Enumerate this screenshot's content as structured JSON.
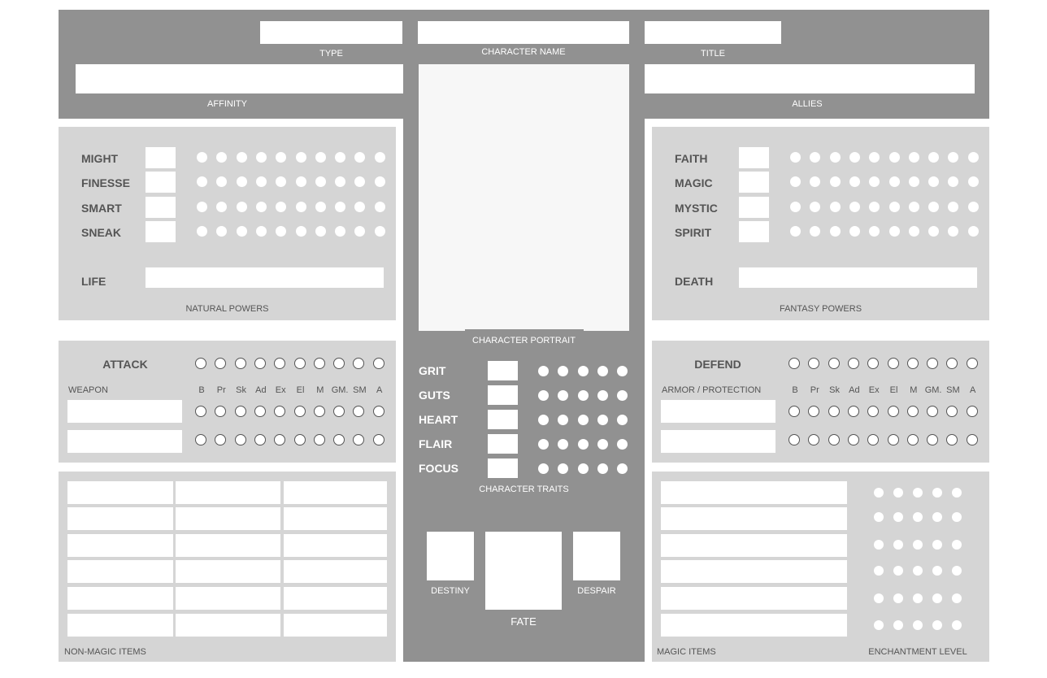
{
  "header": {
    "type_label": "TYPE",
    "name_label": "CHARACTER NAME",
    "title_label": "TITLE",
    "affinity_label": "AFFINITY",
    "allies_label": "ALLIES"
  },
  "portrait_label": "CHARACTER PORTRAIT",
  "natural": {
    "label": "NATURAL POWERS",
    "stats": [
      "MIGHT",
      "FINESSE",
      "SMART",
      "SNEAK"
    ],
    "pool": "LIFE",
    "dots": 10
  },
  "fantasy": {
    "label": "FANTASY POWERS",
    "stats": [
      "FAITH",
      "MAGIC",
      "MYSTIC",
      "SPIRIT"
    ],
    "pool": "DEATH",
    "dots": 10
  },
  "attack": {
    "title": "ATTACK",
    "sub": "WEAPON",
    "columns": [
      "B",
      "Pr",
      "Sk",
      "Ad",
      "Ex",
      "El",
      "M",
      "GM.",
      "SM",
      "A"
    ]
  },
  "defend": {
    "title": "DEFEND",
    "sub": "ARMOR / PROTECTION",
    "columns": [
      "B",
      "Pr",
      "Sk",
      "Ad",
      "Ex",
      "El",
      "M",
      "GM.",
      "SM",
      "A"
    ]
  },
  "traits": {
    "label": "CHARACTER TRAITS",
    "items": [
      "GRIT",
      "GUTS",
      "HEART",
      "FLAIR",
      "FOCUS"
    ],
    "dots": 5
  },
  "fate": {
    "destiny": "DESTINY",
    "fate": "FATE",
    "despair": "DESPAIR"
  },
  "items": {
    "nonmagic": "NON-MAGIC ITEMS",
    "magic": "MAGIC ITEMS",
    "enchant": "ENCHANTMENT LEVEL"
  },
  "colors": {
    "dark": "#919191",
    "light": "#d5d5d5",
    "text": "#555555"
  }
}
